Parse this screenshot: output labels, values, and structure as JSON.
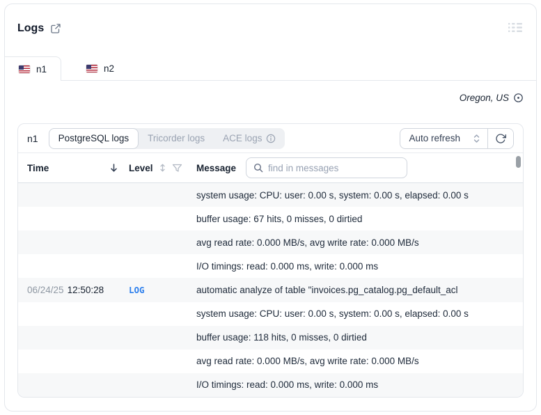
{
  "header": {
    "title": "Logs"
  },
  "tabs": [
    {
      "label": "n1",
      "active": true
    },
    {
      "label": "n2",
      "active": false
    }
  ],
  "region": {
    "label": "Oregon, US"
  },
  "panel": {
    "node_label": "n1",
    "sources": [
      {
        "label": "PostgreSQL logs",
        "active": true
      },
      {
        "label": "Tricorder logs",
        "active": false
      },
      {
        "label": "ACE logs",
        "active": false,
        "has_info": true
      }
    ],
    "auto_refresh_label": "Auto refresh"
  },
  "table": {
    "columns": {
      "time": "Time",
      "level": "Level",
      "message": "Message"
    },
    "search_placeholder": "find in messages",
    "rows": [
      {
        "date": "",
        "time": "",
        "level": "",
        "message": "system usage: CPU: user: 0.00 s, system: 0.00 s, elapsed: 0.00 s"
      },
      {
        "date": "",
        "time": "",
        "level": "",
        "message": "buffer usage: 67 hits, 0 misses, 0 dirtied"
      },
      {
        "date": "",
        "time": "",
        "level": "",
        "message": "avg read rate: 0.000 MB/s, avg write rate: 0.000 MB/s"
      },
      {
        "date": "",
        "time": "",
        "level": "",
        "message": "I/O timings: read: 0.000 ms, write: 0.000 ms"
      },
      {
        "date": "06/24/25",
        "time": "12:50:28",
        "level": "LOG",
        "message": "automatic analyze of table \"invoices.pg_catalog.pg_default_acl"
      },
      {
        "date": "",
        "time": "",
        "level": "",
        "message": "system usage: CPU: user: 0.00 s, system: 0.00 s, elapsed: 0.00 s"
      },
      {
        "date": "",
        "time": "",
        "level": "",
        "message": "buffer usage: 118 hits, 0 misses, 0 dirtied"
      },
      {
        "date": "",
        "time": "",
        "level": "",
        "message": "avg read rate: 0.000 MB/s, avg write rate: 0.000 MB/s"
      },
      {
        "date": "",
        "time": "",
        "level": "",
        "message": "I/O timings: read: 0.000 ms, write: 0.000 ms"
      }
    ]
  },
  "colors": {
    "accent_blue": "#2e80ed",
    "row_stripe": "#f7f8f9",
    "border": "#e4e7ec"
  }
}
